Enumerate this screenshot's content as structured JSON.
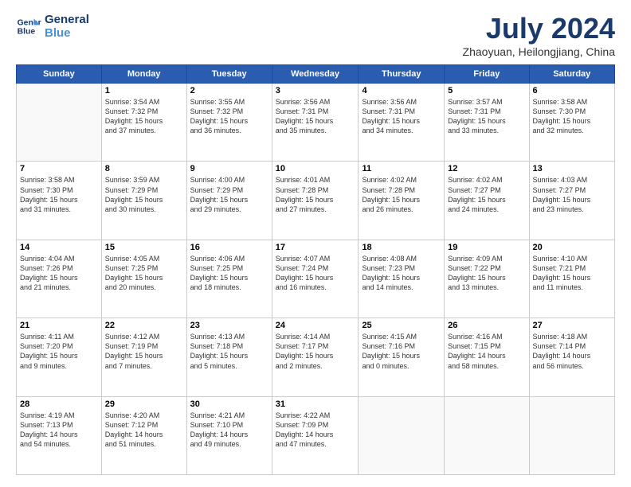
{
  "logo": {
    "line1": "General",
    "line2": "Blue"
  },
  "title": "July 2024",
  "location": "Zhaoyuan, Heilongjiang, China",
  "days_of_week": [
    "Sunday",
    "Monday",
    "Tuesday",
    "Wednesday",
    "Thursday",
    "Friday",
    "Saturday"
  ],
  "weeks": [
    [
      {
        "day": "",
        "info": ""
      },
      {
        "day": "1",
        "info": "Sunrise: 3:54 AM\nSunset: 7:32 PM\nDaylight: 15 hours\nand 37 minutes."
      },
      {
        "day": "2",
        "info": "Sunrise: 3:55 AM\nSunset: 7:32 PM\nDaylight: 15 hours\nand 36 minutes."
      },
      {
        "day": "3",
        "info": "Sunrise: 3:56 AM\nSunset: 7:31 PM\nDaylight: 15 hours\nand 35 minutes."
      },
      {
        "day": "4",
        "info": "Sunrise: 3:56 AM\nSunset: 7:31 PM\nDaylight: 15 hours\nand 34 minutes."
      },
      {
        "day": "5",
        "info": "Sunrise: 3:57 AM\nSunset: 7:31 PM\nDaylight: 15 hours\nand 33 minutes."
      },
      {
        "day": "6",
        "info": "Sunrise: 3:58 AM\nSunset: 7:30 PM\nDaylight: 15 hours\nand 32 minutes."
      }
    ],
    [
      {
        "day": "7",
        "info": "Sunrise: 3:58 AM\nSunset: 7:30 PM\nDaylight: 15 hours\nand 31 minutes."
      },
      {
        "day": "8",
        "info": "Sunrise: 3:59 AM\nSunset: 7:29 PM\nDaylight: 15 hours\nand 30 minutes."
      },
      {
        "day": "9",
        "info": "Sunrise: 4:00 AM\nSunset: 7:29 PM\nDaylight: 15 hours\nand 29 minutes."
      },
      {
        "day": "10",
        "info": "Sunrise: 4:01 AM\nSunset: 7:28 PM\nDaylight: 15 hours\nand 27 minutes."
      },
      {
        "day": "11",
        "info": "Sunrise: 4:02 AM\nSunset: 7:28 PM\nDaylight: 15 hours\nand 26 minutes."
      },
      {
        "day": "12",
        "info": "Sunrise: 4:02 AM\nSunset: 7:27 PM\nDaylight: 15 hours\nand 24 minutes."
      },
      {
        "day": "13",
        "info": "Sunrise: 4:03 AM\nSunset: 7:27 PM\nDaylight: 15 hours\nand 23 minutes."
      }
    ],
    [
      {
        "day": "14",
        "info": "Sunrise: 4:04 AM\nSunset: 7:26 PM\nDaylight: 15 hours\nand 21 minutes."
      },
      {
        "day": "15",
        "info": "Sunrise: 4:05 AM\nSunset: 7:25 PM\nDaylight: 15 hours\nand 20 minutes."
      },
      {
        "day": "16",
        "info": "Sunrise: 4:06 AM\nSunset: 7:25 PM\nDaylight: 15 hours\nand 18 minutes."
      },
      {
        "day": "17",
        "info": "Sunrise: 4:07 AM\nSunset: 7:24 PM\nDaylight: 15 hours\nand 16 minutes."
      },
      {
        "day": "18",
        "info": "Sunrise: 4:08 AM\nSunset: 7:23 PM\nDaylight: 15 hours\nand 14 minutes."
      },
      {
        "day": "19",
        "info": "Sunrise: 4:09 AM\nSunset: 7:22 PM\nDaylight: 15 hours\nand 13 minutes."
      },
      {
        "day": "20",
        "info": "Sunrise: 4:10 AM\nSunset: 7:21 PM\nDaylight: 15 hours\nand 11 minutes."
      }
    ],
    [
      {
        "day": "21",
        "info": "Sunrise: 4:11 AM\nSunset: 7:20 PM\nDaylight: 15 hours\nand 9 minutes."
      },
      {
        "day": "22",
        "info": "Sunrise: 4:12 AM\nSunset: 7:19 PM\nDaylight: 15 hours\nand 7 minutes."
      },
      {
        "day": "23",
        "info": "Sunrise: 4:13 AM\nSunset: 7:18 PM\nDaylight: 15 hours\nand 5 minutes."
      },
      {
        "day": "24",
        "info": "Sunrise: 4:14 AM\nSunset: 7:17 PM\nDaylight: 15 hours\nand 2 minutes."
      },
      {
        "day": "25",
        "info": "Sunrise: 4:15 AM\nSunset: 7:16 PM\nDaylight: 15 hours\nand 0 minutes."
      },
      {
        "day": "26",
        "info": "Sunrise: 4:16 AM\nSunset: 7:15 PM\nDaylight: 14 hours\nand 58 minutes."
      },
      {
        "day": "27",
        "info": "Sunrise: 4:18 AM\nSunset: 7:14 PM\nDaylight: 14 hours\nand 56 minutes."
      }
    ],
    [
      {
        "day": "28",
        "info": "Sunrise: 4:19 AM\nSunset: 7:13 PM\nDaylight: 14 hours\nand 54 minutes."
      },
      {
        "day": "29",
        "info": "Sunrise: 4:20 AM\nSunset: 7:12 PM\nDaylight: 14 hours\nand 51 minutes."
      },
      {
        "day": "30",
        "info": "Sunrise: 4:21 AM\nSunset: 7:10 PM\nDaylight: 14 hours\nand 49 minutes."
      },
      {
        "day": "31",
        "info": "Sunrise: 4:22 AM\nSunset: 7:09 PM\nDaylight: 14 hours\nand 47 minutes."
      },
      {
        "day": "",
        "info": ""
      },
      {
        "day": "",
        "info": ""
      },
      {
        "day": "",
        "info": ""
      }
    ]
  ]
}
